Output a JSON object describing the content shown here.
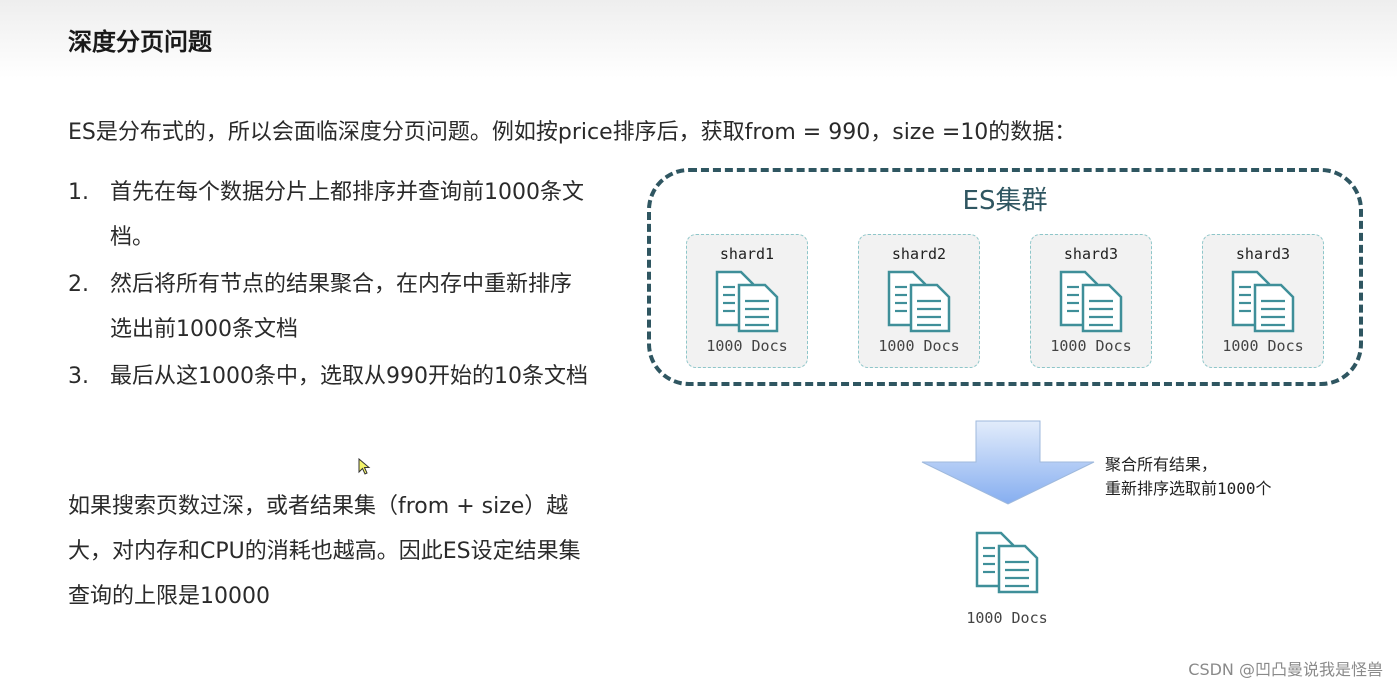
{
  "page": {
    "title": "深度分页问题",
    "intro": "ES是分布式的，所以会面临深度分页问题。例如按price排序后，获取from = 990，size =10的数据："
  },
  "steps": [
    {
      "num": "1.",
      "text": "首先在每个数据分片上都排序并查询前1000条文档。"
    },
    {
      "num": "2.",
      "text": "然后将所有节点的结果聚合，在内存中重新排序选出前1000条文档"
    },
    {
      "num": "3.",
      "text": "最后从这1000条中，选取从990开始的10条文档"
    }
  ],
  "conclusion": "如果搜索页数过深，或者结果集（from + size）越大，对内存和CPU的消耗也越高。因此ES设定结果集查询的上限是10000",
  "diagram": {
    "cluster_title": "ES集群",
    "shards": [
      {
        "name": "shard1",
        "docs": "1000 Docs"
      },
      {
        "name": "shard2",
        "docs": "1000 Docs"
      },
      {
        "name": "shard3",
        "docs": "1000 Docs"
      },
      {
        "name": "shard3",
        "docs": "1000 Docs"
      }
    ],
    "merge_note_line1": "聚合所有结果，",
    "merge_note_line2": "重新排序选取前1000个",
    "result_docs": "1000 Docs",
    "colors": {
      "cluster_border": "#2f5661",
      "shard_border": "#8ec6c9",
      "doc_icon": "#3f8f99",
      "arrow_top": "#e2ecfb",
      "arrow_bottom": "#86aef0"
    }
  },
  "watermark": "CSDN @凹凸曼说我是怪兽"
}
